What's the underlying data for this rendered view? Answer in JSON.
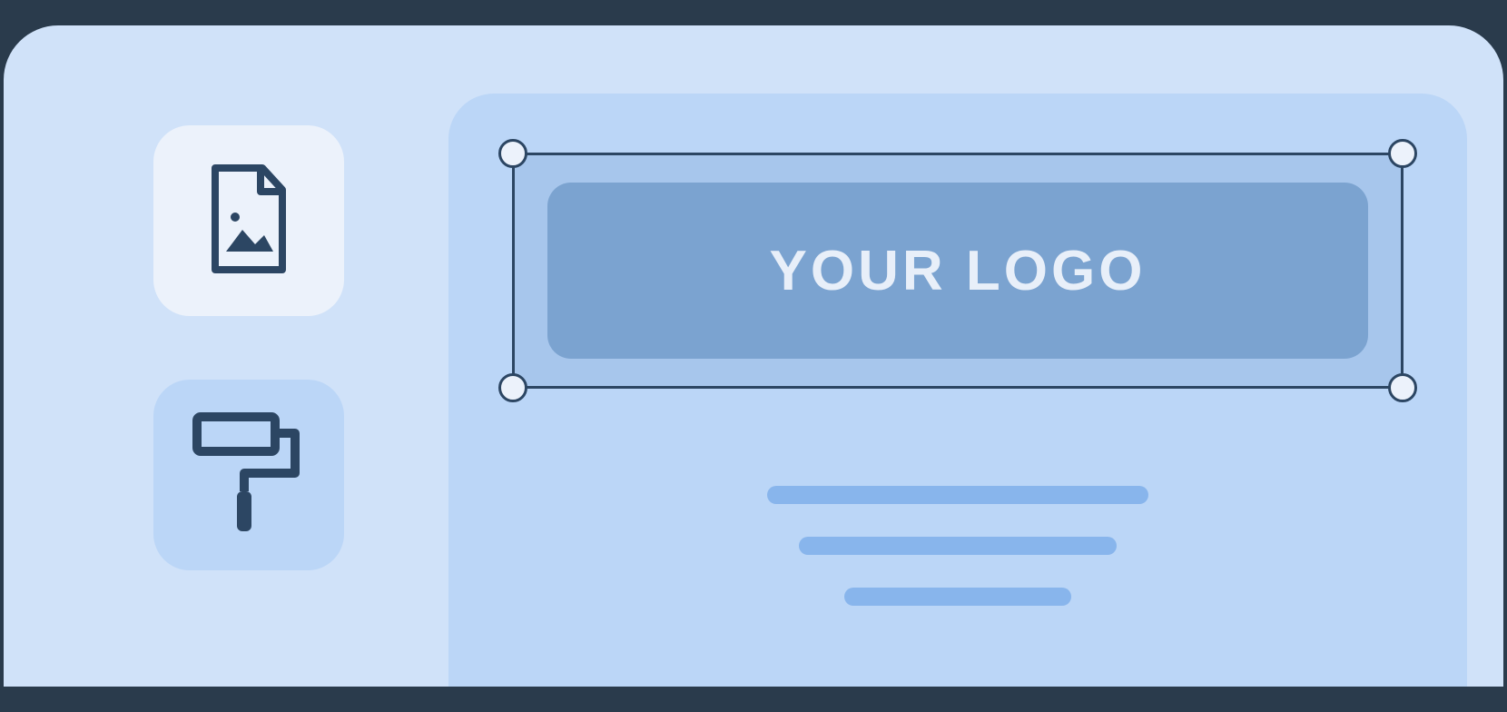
{
  "sidebar": {
    "tools": [
      {
        "name": "image-file-icon"
      },
      {
        "name": "paint-roller-icon"
      }
    ]
  },
  "canvas": {
    "logo_placeholder_text": "YOUR LOGO"
  },
  "colors": {
    "frame_bg": "#d0e2f9",
    "canvas_bg": "#bbd6f7",
    "tool_light_bg": "#ecf2fb",
    "tool_selected_bg": "#bbd6f7",
    "logo_button_bg": "#7ba3d0",
    "selection_bg": "#a7c6ec",
    "stroke_dark": "#2c4663",
    "text_line": "#88b5ec",
    "logo_text": "#e8eff9"
  }
}
